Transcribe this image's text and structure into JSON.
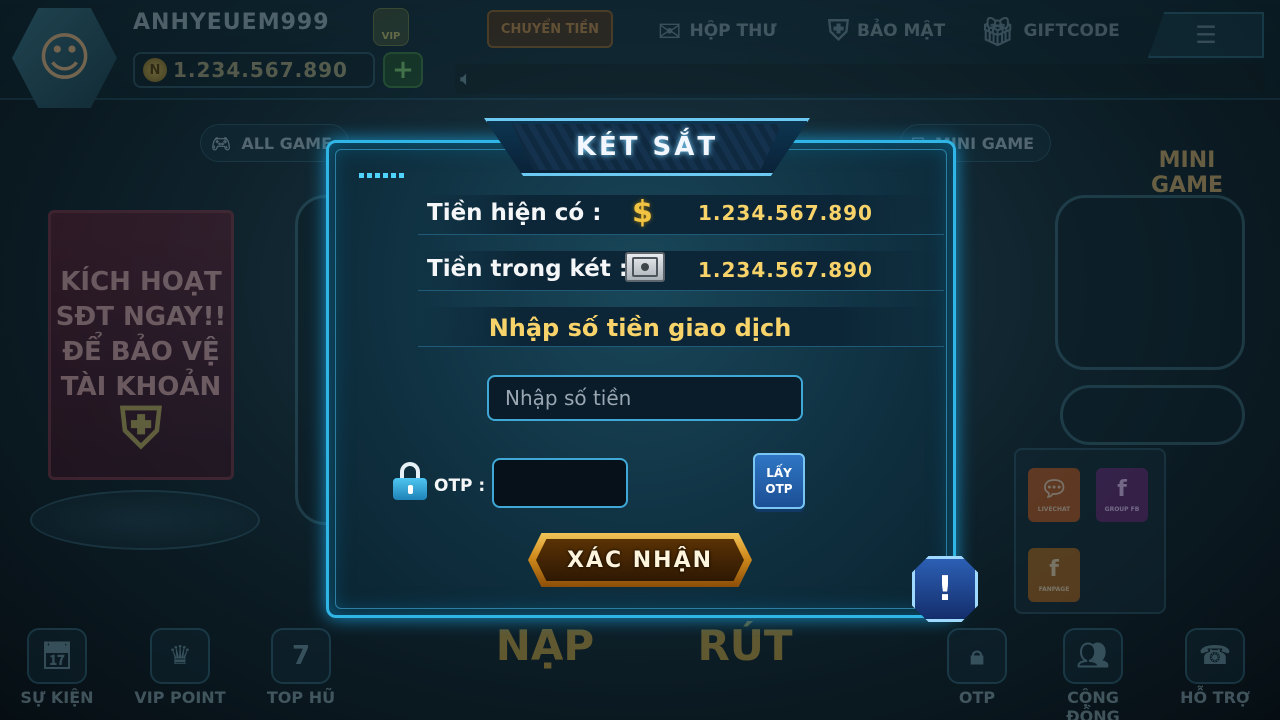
{
  "header": {
    "username": "ANHYEUEM999",
    "vip_label": "VIP",
    "balance": "1.234.567.890",
    "coin_symbol": "N",
    "plus_label": "+",
    "transfer_label": "CHUYỂN TIỀN",
    "nav": [
      {
        "label": "HỘP THƯ",
        "icon": "mail-icon"
      },
      {
        "label": "BẢO MẬT",
        "icon": "shield-icon"
      },
      {
        "label": "GIFTCODE",
        "icon": "gift-icon"
      }
    ],
    "menu_icon": "hamburger-icon"
  },
  "background": {
    "categories": {
      "all_game": "ALL GAME",
      "mini_game": "MINI GAME"
    },
    "promo_lines": [
      "KÍCH HOẠT",
      "SĐT NGAY!!",
      "ĐỂ BẢO VỆ",
      "TÀI KHOẢN"
    ],
    "minigame_logo_top": "MINI",
    "minigame_logo_bottom": "GAME",
    "social": {
      "livechat": "LIVECHAT",
      "group_fb": "GROUP FB",
      "fanpage": "FANPAGE"
    },
    "deposit_label": "NẠP",
    "withdraw_label": "RÚT",
    "bottom_nav": [
      {
        "label": "SỰ KIỆN",
        "icon": "calendar-icon"
      },
      {
        "label": "VIP POINT",
        "icon": "crown-icon"
      },
      {
        "label": "TOP HŨ",
        "icon": "slot-icon"
      },
      {
        "label": "OTP",
        "icon": "lock-icon"
      },
      {
        "label": "CỘNG ĐỒNG",
        "icon": "community-icon"
      },
      {
        "label": "HỖ TRỢ",
        "icon": "support-icon"
      }
    ]
  },
  "dialog": {
    "title": "KÉT SẮT",
    "current_money_label": "Tiền hiện có :",
    "current_money_value": "1.234.567.890",
    "safe_money_label": "Tiền trong két :",
    "safe_money_value": "1.234.567.890",
    "section_title": "Nhập số tiền giao dịch",
    "amount_placeholder": "Nhập số tiền",
    "otp_label": "OTP :",
    "get_otp_label": "LẤY OTP",
    "confirm_label": "XÁC NHẬN",
    "info_label": "!"
  },
  "colors": {
    "gold_text": "#f7d36a",
    "dialog_border": "#2fb6e6",
    "confirm_gold": "#d08a1c"
  }
}
